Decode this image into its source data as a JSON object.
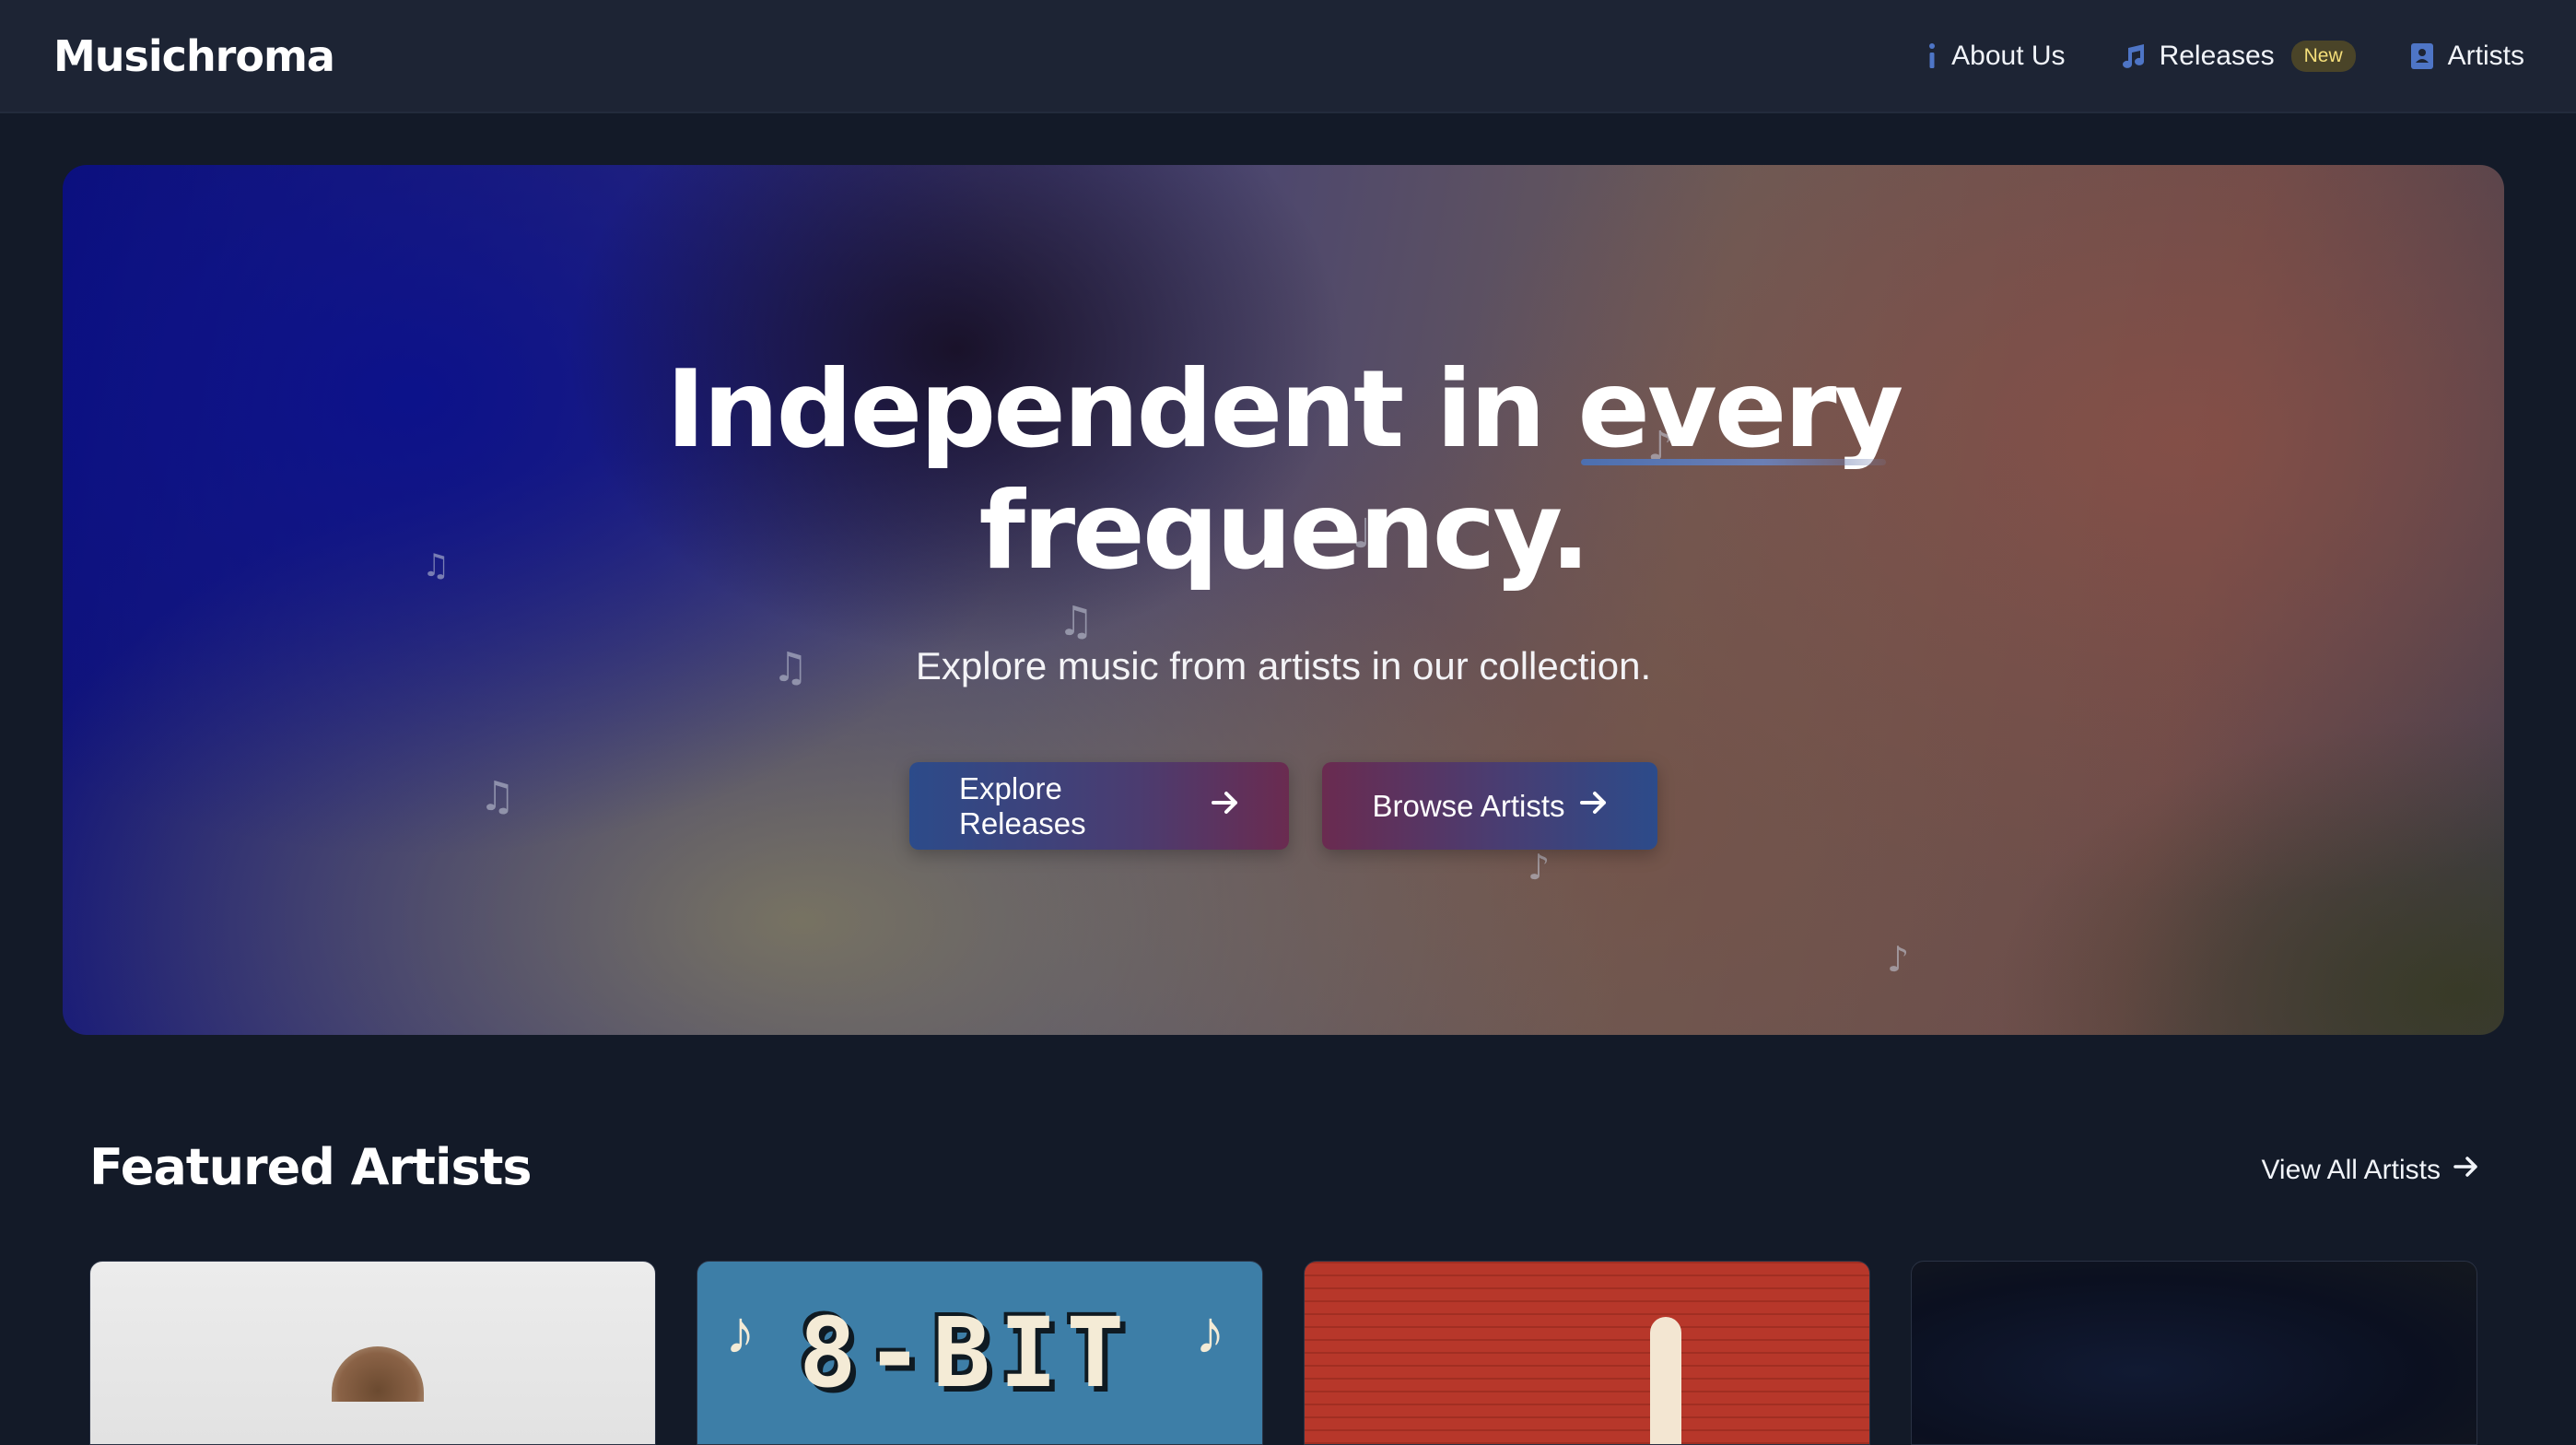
{
  "navbar": {
    "logo": "Musichroma",
    "links": [
      {
        "label": "About Us",
        "icon": "info-icon"
      },
      {
        "label": "Releases",
        "icon": "music-note-icon",
        "badge": "New"
      },
      {
        "label": "Artists",
        "icon": "contact-book-icon"
      }
    ]
  },
  "hero": {
    "title_line1_a": "Independent in ",
    "title_line1_b": "every",
    "title_line2": "frequency.",
    "subtitle": "Explore music from artists in our collection.",
    "buttons": [
      {
        "label": "Explore Releases",
        "icon": "arrow-right-icon"
      },
      {
        "label": "Browse Artists",
        "icon": "arrow-right-icon"
      }
    ]
  },
  "featured": {
    "title": "Featured Artists",
    "view_all": "View All Artists",
    "card2_text": "8-BIT"
  },
  "colors": {
    "page_bg": "#131a28",
    "navbar_bg": "#1d2434",
    "accent_blue": "#4e75c6",
    "badge_text": "#f5df7a"
  }
}
